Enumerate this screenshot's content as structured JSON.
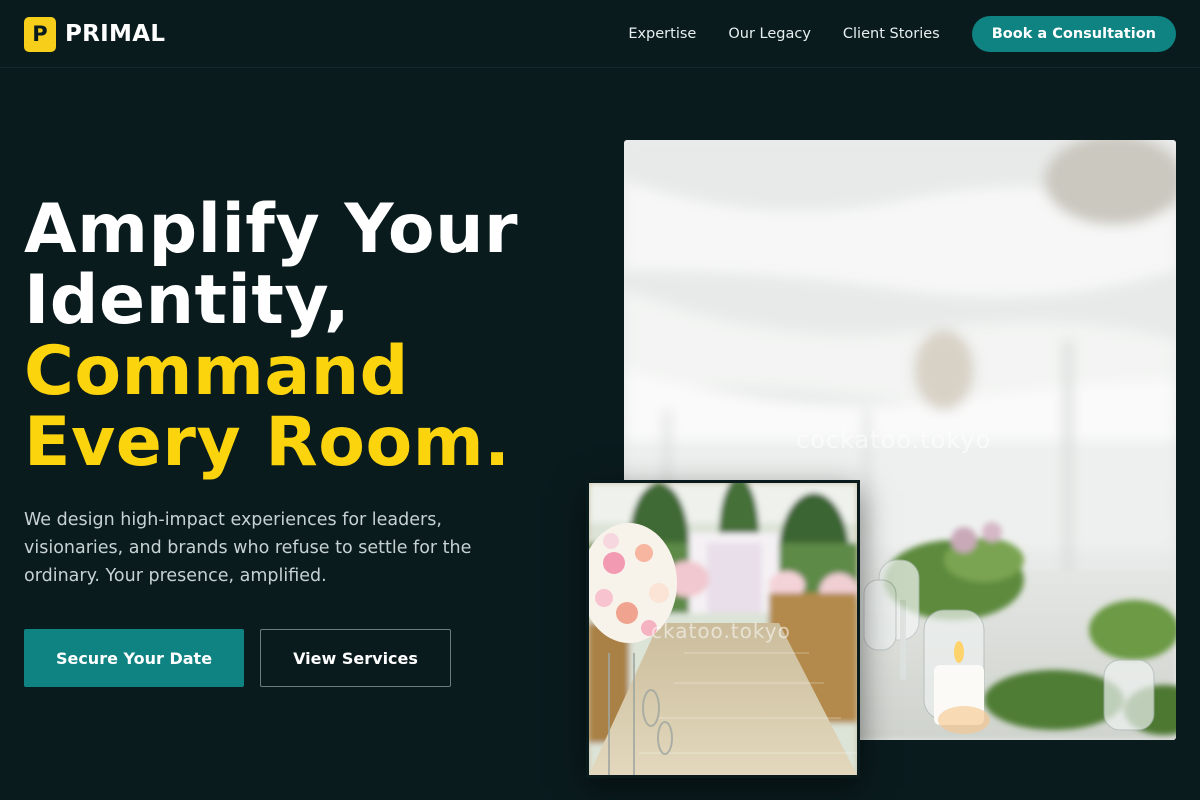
{
  "brand": {
    "logo_letter": "P",
    "name": "PRIMAL",
    "accent": "#f7ce1a"
  },
  "nav": {
    "links": [
      "Expertise",
      "Our Legacy",
      "Client Stories"
    ],
    "cta": "Book a Consultation"
  },
  "hero": {
    "headline_line1": "Amplify Your",
    "headline_line2": "Identity,",
    "headline_accent_line1": "Command",
    "headline_accent_line2": "Every Room.",
    "subtext": "We design high-impact experiences for leaders, visionaries, and brands who refuse to settle for the ordinary. Your presence, amplified.",
    "primary_button": "Secure Your Date",
    "secondary_button": "View Services"
  },
  "images": {
    "main_watermark": "cockatoo.tokyo",
    "inset_watermark": "ckatoo.tokyo"
  },
  "colors": {
    "background": "#0a1b1e",
    "teal": "#0f8282",
    "yellow": "#fbd40d"
  }
}
